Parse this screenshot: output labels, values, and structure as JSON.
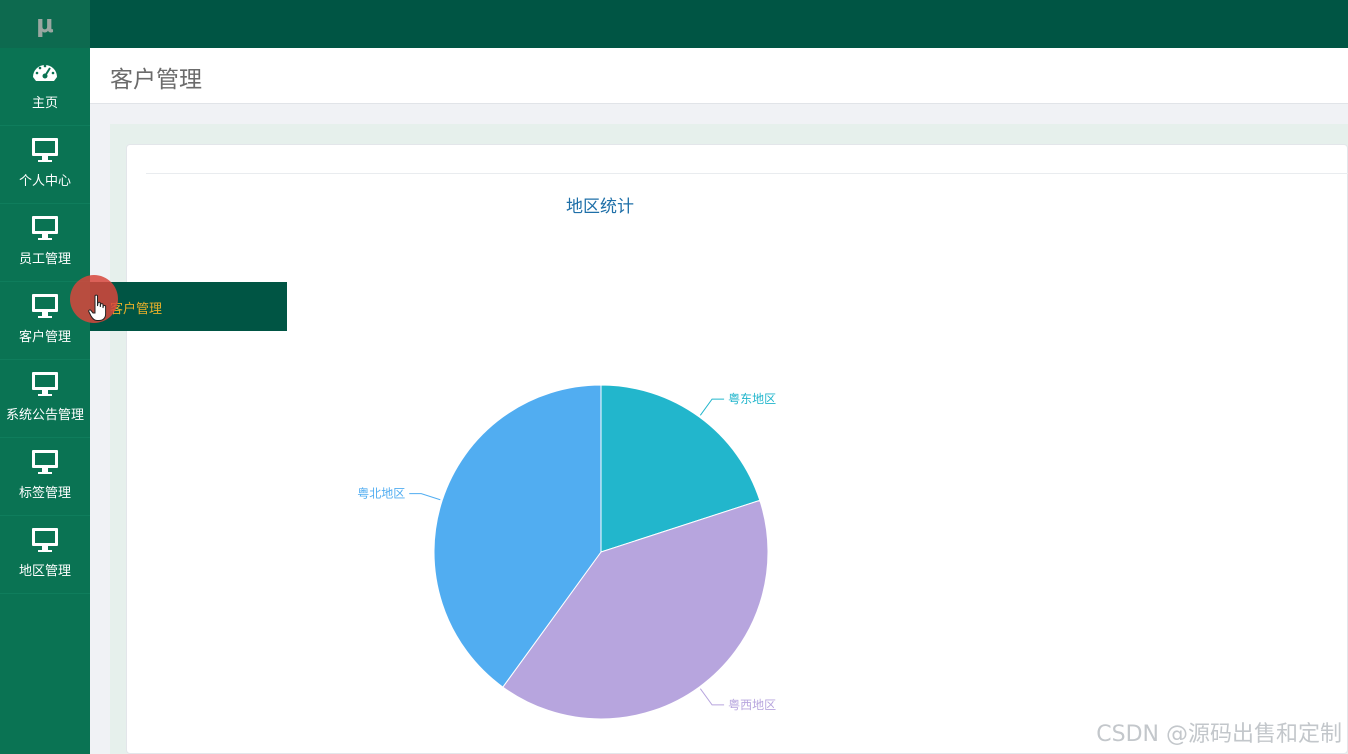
{
  "app": {
    "logo_text": "μ"
  },
  "sidebar": {
    "items": [
      {
        "label": "主页",
        "icon": "dashboard-icon"
      },
      {
        "label": "个人中心",
        "icon": "monitor-icon"
      },
      {
        "label": "员工管理",
        "icon": "monitor-icon"
      },
      {
        "label": "客户管理",
        "icon": "monitor-icon"
      },
      {
        "label": "系统公告管理",
        "icon": "monitor-icon"
      },
      {
        "label": "标签管理",
        "icon": "monitor-icon"
      },
      {
        "label": "地区管理",
        "icon": "monitor-icon"
      }
    ]
  },
  "header": {
    "title": "客户管理"
  },
  "submenu": {
    "item_label": "客户管理"
  },
  "watermark": "CSDN @源码出售和定制",
  "colors": {
    "topbar": "#005544",
    "sidebar": "#0a7353",
    "submenu_text": "#e8b02a"
  },
  "chart_data": {
    "type": "pie",
    "title": "地区统计",
    "slices": [
      {
        "name": "粤东地区",
        "value": 20,
        "color": "#22b6cc"
      },
      {
        "name": "粤西地区",
        "value": 40,
        "color": "#b7a5de"
      },
      {
        "name": "粤北地区",
        "value": 40,
        "color": "#51adf1"
      }
    ]
  }
}
